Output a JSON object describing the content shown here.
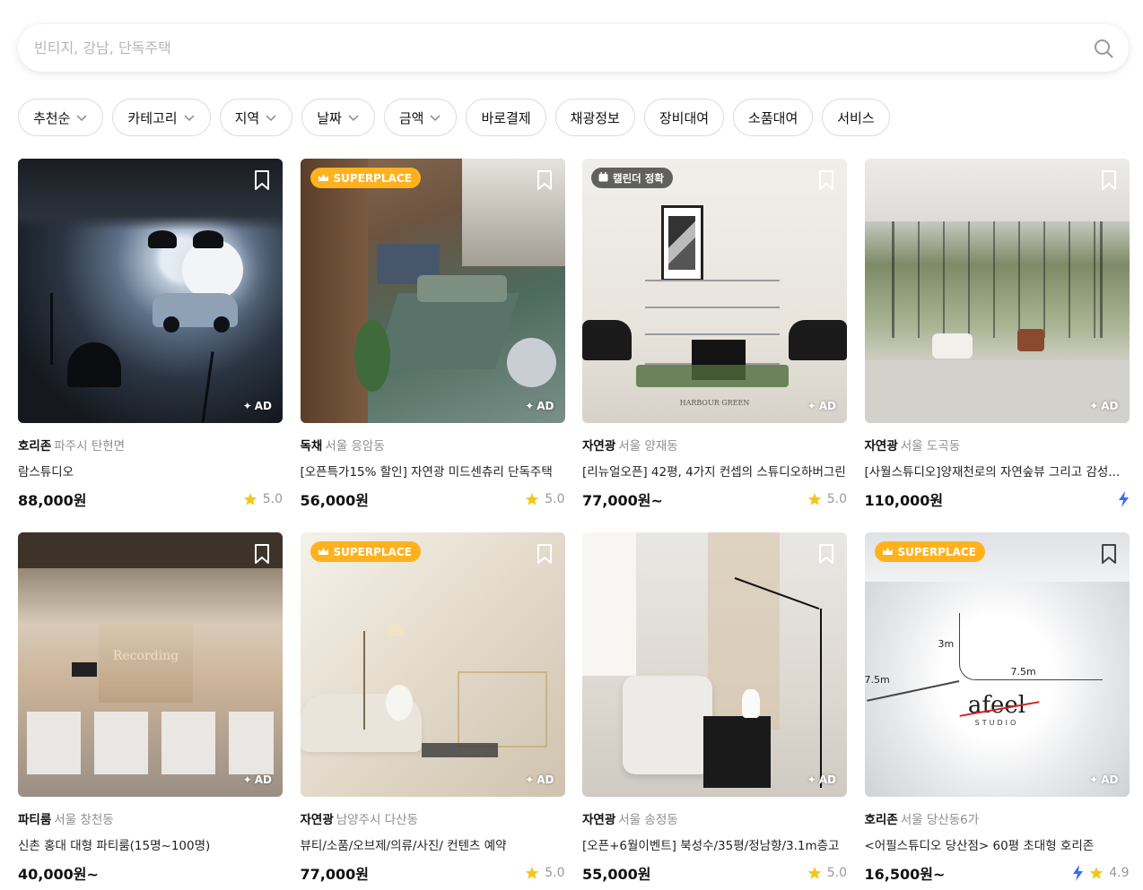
{
  "search": {
    "placeholder": "빈티지, 강남, 단독주택"
  },
  "filters": [
    {
      "label": "추천순",
      "dropdown": true
    },
    {
      "label": "카테고리",
      "dropdown": true
    },
    {
      "label": "지역",
      "dropdown": true
    },
    {
      "label": "날짜",
      "dropdown": true
    },
    {
      "label": "금액",
      "dropdown": true
    },
    {
      "label": "바로결제",
      "dropdown": false
    },
    {
      "label": "채광정보",
      "dropdown": false
    },
    {
      "label": "장비대여",
      "dropdown": false
    },
    {
      "label": "소품대여",
      "dropdown": false
    },
    {
      "label": "서비스",
      "dropdown": false
    }
  ],
  "badges": {
    "superplace": "SUPERPLACE",
    "calendar": "캘린더 정확",
    "ad": "AD"
  },
  "listings": [
    {
      "category": "호리존",
      "location": "파주시 탄현면",
      "title": "람스튜디오",
      "price": "88,000원",
      "rating": "5.0",
      "instant": false,
      "badge": null
    },
    {
      "category": "독채",
      "location": "서울 응암동",
      "title": "[오픈특가15% 할인] 자연광 미드센츄리 단독주택",
      "price": "56,000원",
      "rating": "5.0",
      "instant": false,
      "badge": "superplace"
    },
    {
      "category": "자연광",
      "location": "서울 양재동",
      "title": "[리뉴얼오픈] 42평, 4가지 컨셉의 스튜디오하버그린",
      "price": "77,000원~",
      "rating": "5.0",
      "instant": false,
      "badge": "calendar"
    },
    {
      "category": "자연광",
      "location": "서울 도곡동",
      "title": "[사월스튜디오]양재천로의 자연숲뷰 그리고 감성...",
      "price": "110,000원",
      "rating": "",
      "instant": true,
      "badge": null
    },
    {
      "category": "파티룸",
      "location": "서울 창천동",
      "title": "신촌 홍대 대형 파티룸(15명~100명)",
      "price": "40,000원~",
      "rating": "",
      "instant": false,
      "badge": null
    },
    {
      "category": "자연광",
      "location": "남양주시 다산동",
      "title": "뷰티/소품/오브제/의류/사진/ 컨텐츠 예약",
      "price": "77,000원",
      "rating": "5.0",
      "instant": false,
      "badge": "superplace"
    },
    {
      "category": "자연광",
      "location": "서울 송정동",
      "title": "[오픈+6월이벤트] 북성수/35평/정남향/3.1m층고",
      "price": "55,000원",
      "rating": "5.0",
      "instant": false,
      "badge": null
    },
    {
      "category": "호리존",
      "location": "서울 당산동6가",
      "title": "<어필스튜디오 당산점> 60평 초대형 호리존",
      "price": "16,500원~",
      "rating": "4.9",
      "instant": true,
      "badge": "superplace"
    }
  ],
  "scene_text": {
    "harbour": "HARBOUR GREEN",
    "recording": "Recording",
    "afeel": "afeel",
    "studio": "STUDIO",
    "dim_3m": "3m",
    "dim_7_5m_a": "7.5m",
    "dim_7_5m_b": "7.5m"
  },
  "colors": {
    "superplace": "#ffb21e",
    "star": "#f5c518",
    "bolt": "#3d6cf0"
  }
}
